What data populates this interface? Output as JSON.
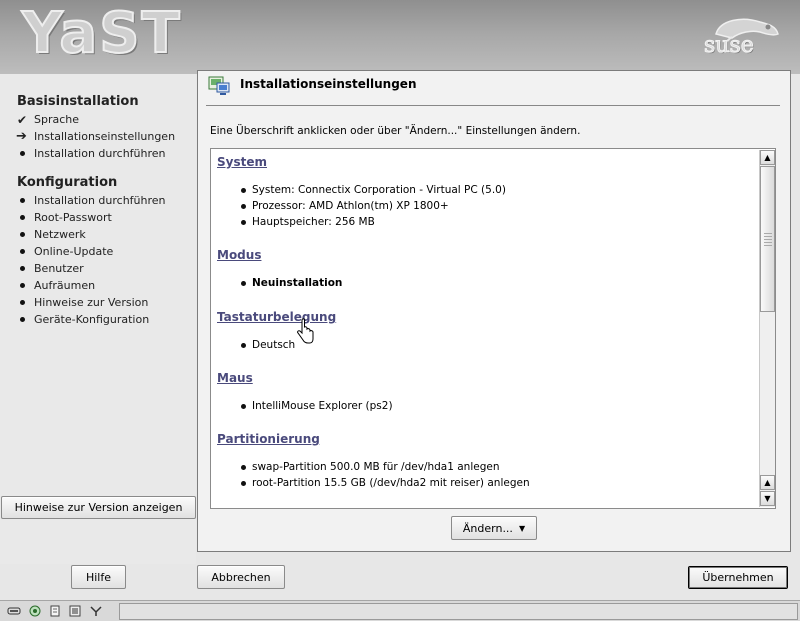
{
  "header": {
    "app_logo": "YaST",
    "brand_logo": "suse"
  },
  "sidebar": {
    "sections": [
      {
        "heading": "Basisinstallation",
        "items": [
          {
            "label": "Sprache",
            "status": "done"
          },
          {
            "label": "Installationseinstellungen",
            "status": "current"
          },
          {
            "label": "Installation durchführen",
            "status": "pending"
          }
        ]
      },
      {
        "heading": "Konfiguration",
        "items": [
          {
            "label": "Installation durchführen",
            "status": "pending"
          },
          {
            "label": "Root-Passwort",
            "status": "pending"
          },
          {
            "label": "Netzwerk",
            "status": "pending"
          },
          {
            "label": "Online-Update",
            "status": "pending"
          },
          {
            "label": "Benutzer",
            "status": "pending"
          },
          {
            "label": "Aufräumen",
            "status": "pending"
          },
          {
            "label": "Hinweise zur Version",
            "status": "pending"
          },
          {
            "label": "Geräte-Konfiguration",
            "status": "pending"
          }
        ]
      }
    ],
    "release_notes_button": "Hinweise zur Version anzeigen"
  },
  "main": {
    "title": "Installationseinstellungen",
    "instruction": "Eine Überschrift anklicken oder über \"Ändern...\" Einstellungen ändern.",
    "sections": [
      {
        "title": "System",
        "items": [
          "System: Connectix Corporation - Virtual PC (5.0)",
          "Prozessor: AMD Athlon(tm) XP 1800+",
          "Hauptspeicher: 256 MB"
        ]
      },
      {
        "title": "Modus",
        "items": [
          "Neuinstallation"
        ]
      },
      {
        "title": "Tastaturbelegung",
        "items": [
          "Deutsch"
        ]
      },
      {
        "title": "Maus",
        "items": [
          "IntelliMouse Explorer (ps2)"
        ]
      },
      {
        "title": "Partitionierung",
        "items": [
          "swap-Partition 500.0 MB für /dev/hda1 anlegen",
          "root-Partition 15.5 GB (/dev/hda2 mit reiser) anlegen"
        ]
      }
    ],
    "change_button": "Ändern...",
    "change_button_arrow": "▼"
  },
  "footer": {
    "help_button": "Hilfe",
    "cancel_button": "Abbrechen",
    "accept_button": "Übernehmen"
  },
  "colors": {
    "section_link": "#4a4a7c",
    "banner": "#a7a7a7",
    "background": "#e7e7e7"
  }
}
